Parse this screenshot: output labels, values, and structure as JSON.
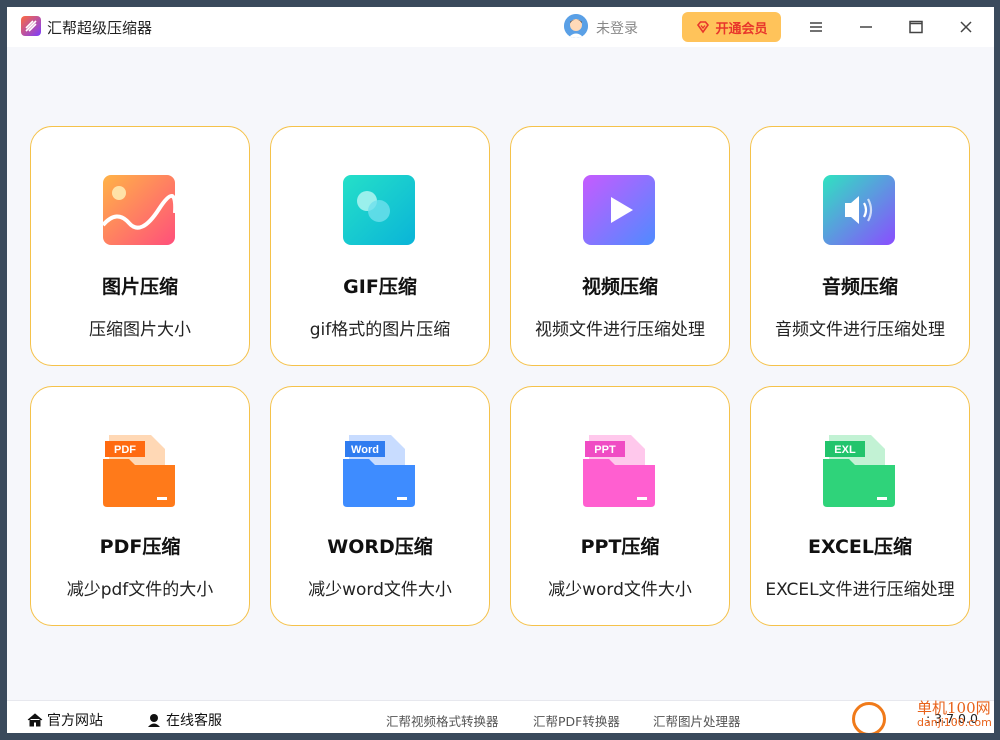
{
  "app": {
    "title": "汇帮超级压缩器",
    "login_text": "未登录",
    "vip_label": "开通会员"
  },
  "cards": [
    {
      "title": "图片压缩",
      "desc": "压缩图片大小",
      "icon": "image-icon"
    },
    {
      "title": "GIF压缩",
      "desc": "gif格式的图片压缩",
      "icon": "gif-icon"
    },
    {
      "title": "视频压缩",
      "desc": "视频文件进行压缩处理",
      "icon": "video-play-icon"
    },
    {
      "title": "音频压缩",
      "desc": "音频文件进行压缩处理",
      "icon": "audio-speaker-icon"
    },
    {
      "title": "PDF压缩",
      "desc": "减少pdf文件的大小",
      "icon": "pdf-folder-icon",
      "badge": "PDF"
    },
    {
      "title": "WORD压缩",
      "desc": "减少word文件大小",
      "icon": "word-folder-icon",
      "badge": "Word"
    },
    {
      "title": "PPT压缩",
      "desc": "减少word文件大小",
      "icon": "ppt-folder-icon",
      "badge": "PPT"
    },
    {
      "title": "EXCEL压缩",
      "desc": "EXCEL文件进行压缩处理",
      "icon": "excel-folder-icon",
      "badge": "EXL"
    }
  ],
  "footer": {
    "website": "官方网站",
    "support": "在线客服",
    "tools": [
      "汇帮视频格式转换器",
      "汇帮PDF转换器",
      "汇帮图片处理器"
    ],
    "version": ": 3.7.0.0",
    "watermark_text": "单机100网",
    "watermark_url": "danji100.com"
  },
  "colors": {
    "card_border": "#f5c24a",
    "vip_bg": "#ffc35a",
    "vip_text": "#e8362b"
  }
}
